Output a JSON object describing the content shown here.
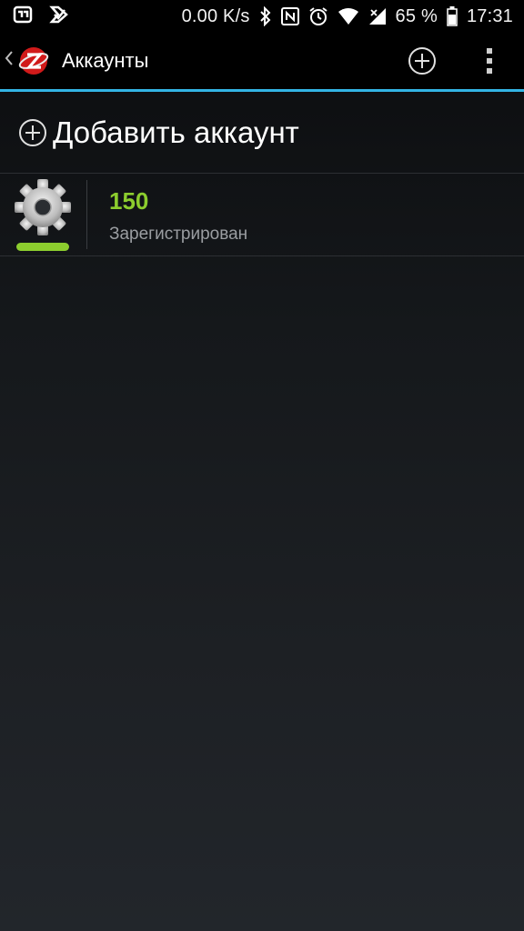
{
  "status_bar": {
    "network_speed": "0.00 K/s",
    "battery_percent": "65 %",
    "time": "17:31",
    "icons": [
      "notification-app-icon",
      "notification-app-icon-2",
      "bluetooth-icon",
      "nfc-icon",
      "alarm-icon",
      "wifi-icon",
      "signal-icon",
      "battery-icon"
    ]
  },
  "action_bar": {
    "title": "Аккаунты",
    "accent_color": "#33b5e5",
    "icons": [
      "back-chevron-icon",
      "app-logo-icon",
      "add-icon",
      "overflow-menu-icon"
    ]
  },
  "add_account": {
    "label": "Добавить аккаунт"
  },
  "accounts": [
    {
      "name": "150",
      "status": "Зарегистрирован",
      "status_color": "#8ccd2e",
      "icon": "gear-icon"
    }
  ]
}
